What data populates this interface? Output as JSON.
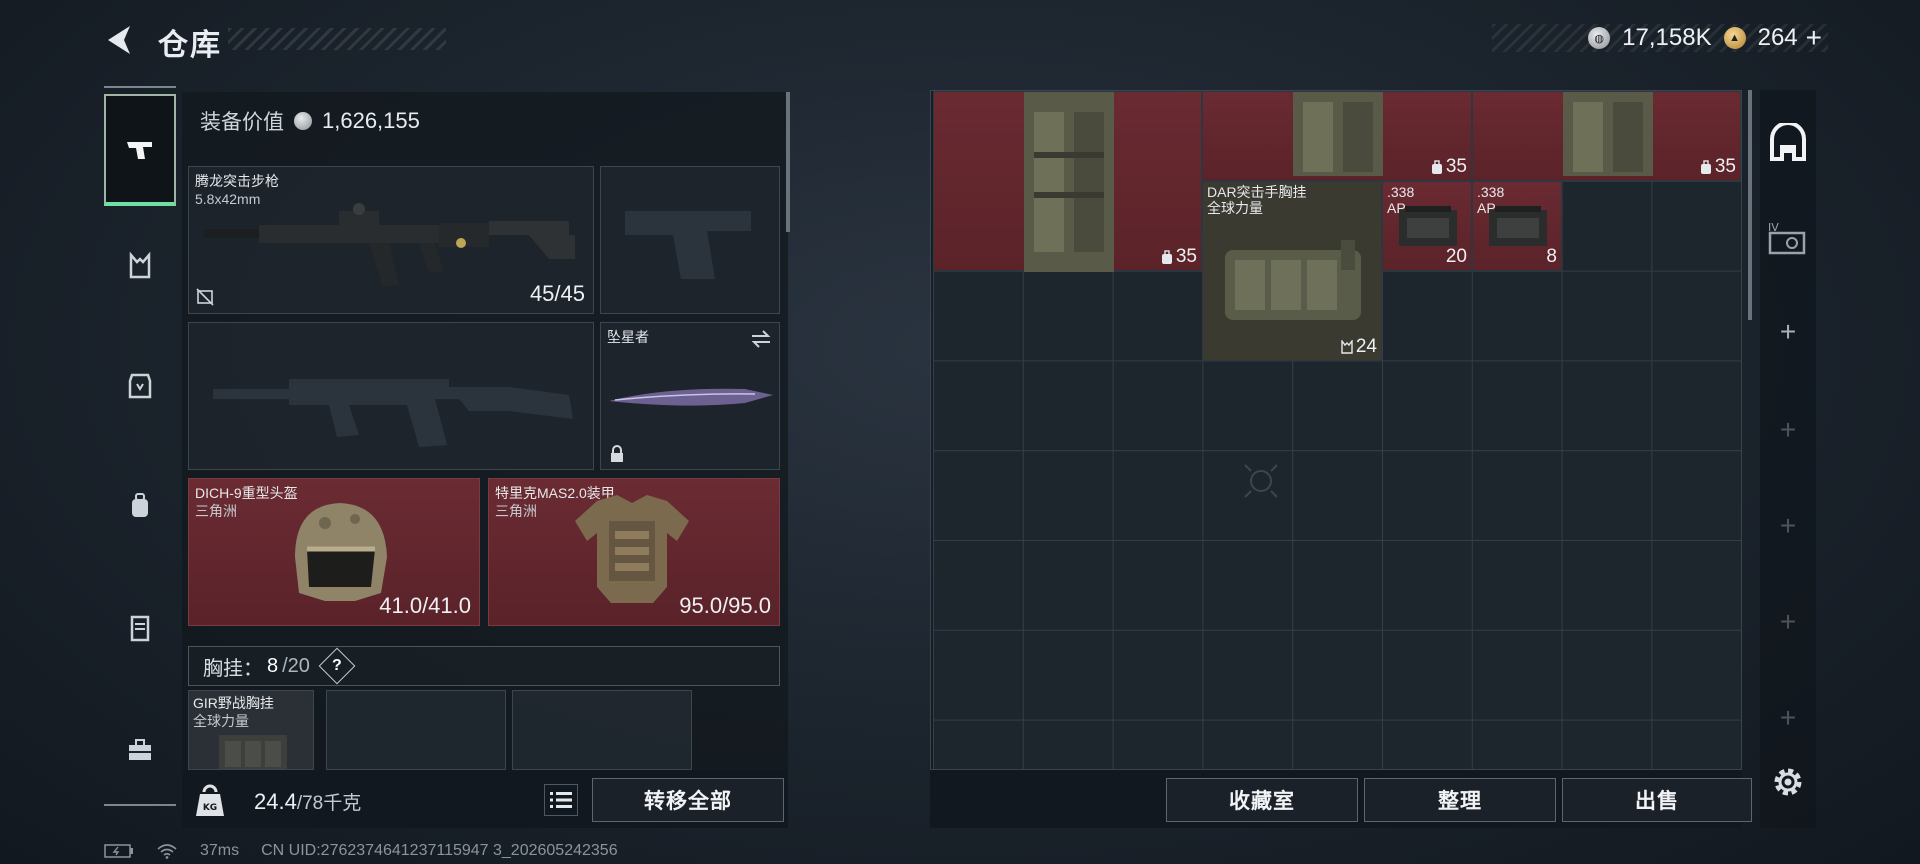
{
  "header": {
    "title": "仓库",
    "silver_amount": "17,158K",
    "gold_amount": "264",
    "gold_plus": "+",
    "icons": {
      "back": "back-arrow-icon",
      "silver": "silver-coin-icon",
      "gold": "gold-coin-icon"
    }
  },
  "sidebar": {
    "items": [
      {
        "icon": "pistol-icon",
        "active": true
      },
      {
        "icon": "vest-icon",
        "active": false
      },
      {
        "icon": "armor-plate-icon",
        "active": false
      },
      {
        "icon": "backpack-icon",
        "active": false
      },
      {
        "icon": "locker-icon",
        "active": false
      },
      {
        "icon": "toolbox-icon",
        "active": false
      }
    ]
  },
  "loadout": {
    "equip_value_label": "装备价值",
    "equip_value": "1,626,155",
    "primary_weapon": {
      "name": "腾龙突击步枪",
      "caliber": "5.8x42mm",
      "ammo": "45/45"
    },
    "melee": {
      "name": "坠星者"
    },
    "helmet": {
      "name": "DICH-9重型头盔",
      "brand": "三角洲",
      "durability": "41.0/41.0"
    },
    "armor": {
      "name": "特里克MAS2.0装甲",
      "brand": "三角洲",
      "durability": "95.0/95.0"
    },
    "chest_rig": {
      "label": "胸挂：",
      "used": "8",
      "capacity": "/20",
      "help": "?"
    },
    "chest_item": {
      "name": "GIR野战胸挂",
      "brand": "全球力量"
    },
    "weight": {
      "current": "24.4",
      "max": "/78千克"
    },
    "transfer_all": "转移全部"
  },
  "stash": {
    "items": [
      {
        "count": "35"
      },
      {
        "count": "35"
      },
      {
        "count": "35"
      },
      {
        "name": "DAR突击手胸挂",
        "brand": "全球力量",
        "count": "24"
      },
      {
        "name": ".338",
        "sub": "AP",
        "count": "20"
      },
      {
        "name": ".338",
        "sub": "AP",
        "count": "8"
      }
    ],
    "buttons": {
      "collection": "收藏室",
      "sort": "整理",
      "sell": "出售"
    }
  },
  "status": {
    "ping": "37ms",
    "uid": "CN UID:2762374641237115947 3_202605242356"
  },
  "colors": {
    "accent": "#6fe0a3",
    "rare_red": "#6b2b33",
    "background": "#1b232c"
  }
}
